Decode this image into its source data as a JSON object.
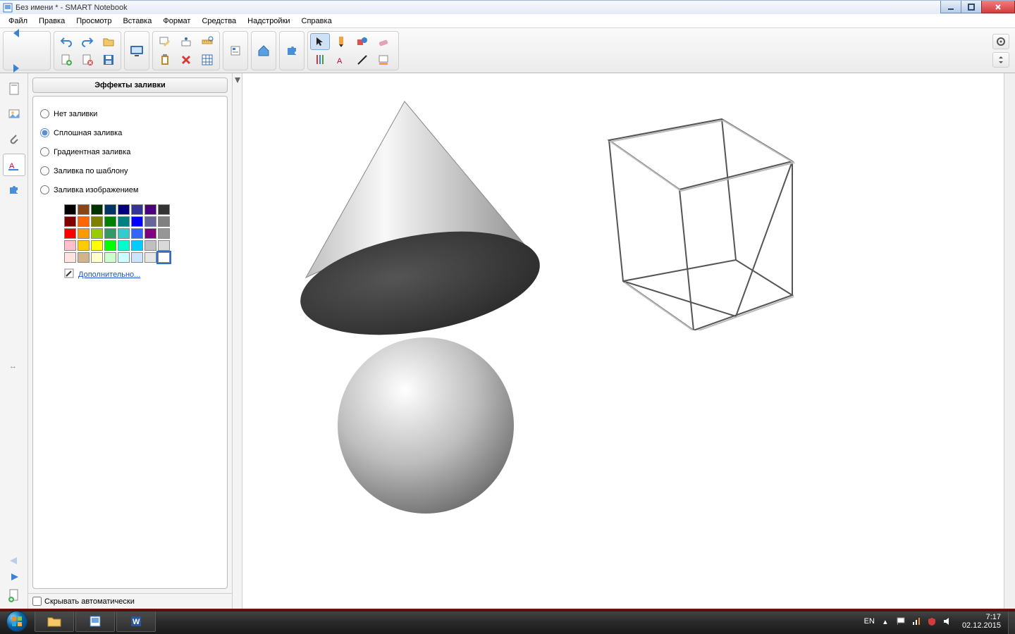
{
  "window": {
    "title": "Без имени * - SMART Notebook"
  },
  "menu": {
    "items": [
      "Файл",
      "Правка",
      "Просмотр",
      "Вставка",
      "Формат",
      "Средства",
      "Надстройки",
      "Справка"
    ]
  },
  "toolbar": {
    "icons": {
      "back": "back",
      "forward": "forward",
      "undo": "undo",
      "redo": "redo",
      "open": "open",
      "new_page": "new_page",
      "delete_page": "delete_page",
      "save": "save",
      "screen_capture": "screen_capture",
      "doc_cam": "doc_cam",
      "insert_table": "insert_table",
      "measure": "measure",
      "clipboard": "clipboard",
      "delete": "delete",
      "table": "table",
      "properties": "properties",
      "addons": "addons",
      "puzzle": "puzzle",
      "select": "select",
      "marker": "marker",
      "shape": "shape",
      "eraser": "eraser",
      "pens": "pens",
      "text": "text",
      "line": "line",
      "fill_color": "fill_color",
      "gear": "gear",
      "vexpand": "vexpand"
    }
  },
  "sidebar_tabs": {
    "items": [
      "page-sorter",
      "gallery",
      "attachments",
      "properties",
      "addons"
    ],
    "bottom": [
      "prev-page-arrow",
      "next-page-arrow",
      "add-page"
    ]
  },
  "panel": {
    "title": "Эффекты заливки",
    "options": {
      "none": "Нет заливки",
      "solid": "Сплошная заливка",
      "gradient": "Градиентная заливка",
      "pattern": "Заливка по шаблону",
      "image": "Заливка изображением"
    },
    "selected": "solid",
    "more": "Дополнительно...",
    "auto_hide": "Скрывать автоматически",
    "palette": [
      [
        "#000000",
        "#8b4513",
        "#003300",
        "#003366",
        "#000080",
        "#333399",
        "#4b0082",
        "#333333"
      ],
      [
        "#800000",
        "#ff6600",
        "#808000",
        "#008000",
        "#008080",
        "#0000ff",
        "#666699",
        "#808080"
      ],
      [
        "#ff0000",
        "#ff9900",
        "#99cc00",
        "#339966",
        "#33cccc",
        "#3366ff",
        "#800080",
        "#969696"
      ],
      [
        "#ffc0cb",
        "#ffcc00",
        "#ffff00",
        "#00ff00",
        "#00ffcc",
        "#00ccff",
        "#c0c0c0",
        "#d9d9d9"
      ],
      [
        "#ffe4e1",
        "#d2b48c",
        "#ffffcc",
        "#ccffcc",
        "#ccffff",
        "#cce5ff",
        "#e6e6e6",
        "#ffffff"
      ]
    ],
    "selected_swatch": [
      4,
      7
    ]
  },
  "shapes": {
    "cone": "cone",
    "cube": "cube",
    "sphere": "sphere"
  },
  "taskbar": {
    "lang": "EN",
    "time": "7:17",
    "date": "02.12.2015",
    "apps": [
      "explorer",
      "smart-notebook",
      "word"
    ]
  }
}
